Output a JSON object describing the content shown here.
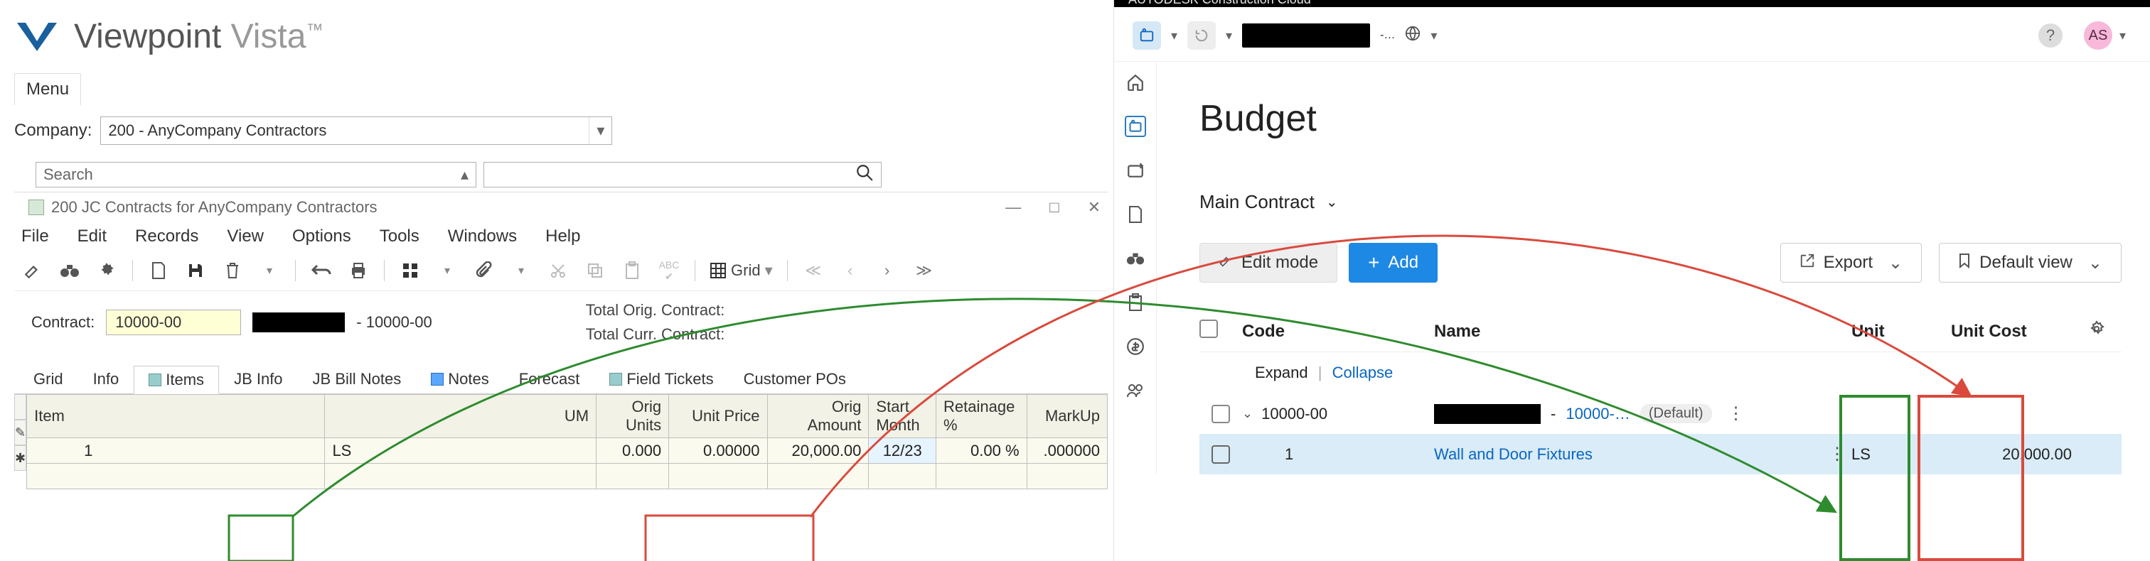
{
  "left": {
    "logo_text": "Viewpoint",
    "logo_sub": "Vista",
    "logo_tm": "™",
    "menu": "Menu",
    "company_label": "Company:",
    "company_value": "200 - AnyCompany Contractors",
    "search_placeholder": "Search",
    "inner_title": "200 JC Contracts for AnyCompany Contractors",
    "menus": [
      "File",
      "Edit",
      "Records",
      "View",
      "Options",
      "Tools",
      "Windows",
      "Help"
    ],
    "grid_btn": "Grid",
    "contract_label": "Contract:",
    "contract_value": "10000-00",
    "contract_desc_suffix": "- 10000-00",
    "total_orig_label": "Total Orig. Contract:",
    "total_curr_label": "Total Curr. Contract:",
    "tabs": [
      "Grid",
      "Info",
      "Items",
      "JB Info",
      "JB Bill Notes",
      "Notes",
      "Forecast",
      "Field Tickets",
      "Customer POs"
    ],
    "active_tab": "Items",
    "columns": [
      "Item",
      "UM",
      "Orig Units",
      "Unit Price",
      "Orig Amount",
      "Start Month",
      "Retainage %",
      "MarkUp"
    ],
    "row": {
      "item": "1",
      "um": "LS",
      "orig_units": "0.000",
      "unit_price": "0.00000",
      "orig_amount": "20,000.00",
      "start_month": "12/23",
      "retainage": "0.00 %",
      "markup": ".000000"
    }
  },
  "right": {
    "brand": "AUTODESK Construction Cloud",
    "dots_suffix": "-…",
    "page_title": "Budget",
    "sub_label": "Main Contract",
    "edit_btn": "Edit mode",
    "add_btn": "Add",
    "export_btn": "Export",
    "default_view_btn": "Default view",
    "avatar": "AS",
    "columns": {
      "code": "Code",
      "name": "Name",
      "unit": "Unit",
      "unit_cost": "Unit Cost"
    },
    "expand": "Expand",
    "collapse": "Collapse",
    "group": {
      "code": "10000-00",
      "link_suffix": "10000-…",
      "badge": "(Default)"
    },
    "item": {
      "code": "1",
      "name": "Wall and Door Fixtures",
      "unit": "LS",
      "unit_cost": "20,000.00"
    }
  }
}
